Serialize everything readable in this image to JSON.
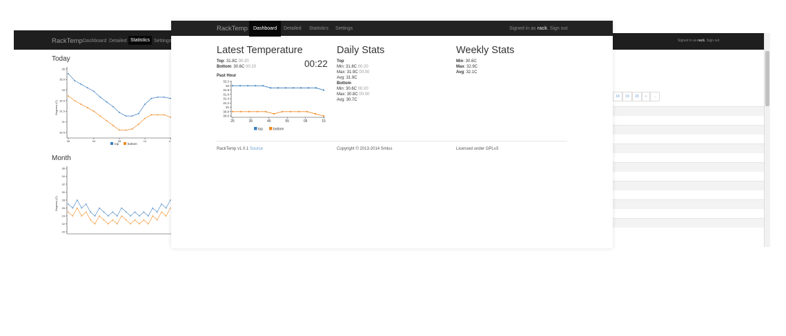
{
  "left_screen": {
    "brand": "RackTemp",
    "nav": [
      "Dashboard",
      "Detailed",
      "Statistics",
      "Settings"
    ],
    "active_nav": "Statistics",
    "today_title": "Today",
    "month_title": "Month",
    "ylabel": "Degrees (C)"
  },
  "main_screen": {
    "brand": "RackTemp",
    "nav": [
      "Dashboard",
      "Detailed",
      "Statistics",
      "Settings"
    ],
    "active_nav": "Dashboard",
    "signed_in_prefix": "Signed in as",
    "user": "rack",
    "signout": "Sign out",
    "latest": {
      "title": "Latest Temperature",
      "top_label": "Top",
      "top_value": "31.8C",
      "top_time": "00:20",
      "bottom_label": "Bottom",
      "bottom_value": "30.6C",
      "bottom_time": "00:20",
      "clock": "00:22",
      "past_hour": "Past Hour"
    },
    "daily": {
      "title": "Daily Stats",
      "top_heading": "Top",
      "top_min": "Min: 31.8C",
      "top_min_time": "00:20",
      "top_max": "Max: 31.9C",
      "top_max_time": "00:00",
      "top_avg": "Avg: 31.9C",
      "bottom_heading": "Bottom",
      "bottom_min": "Min: 30.6C",
      "bottom_min_time": "00:20",
      "bottom_max": "Max: 30.8C",
      "bottom_max_time": "00:00",
      "bottom_avg": "Avg: 30.7C"
    },
    "weekly": {
      "title": "Weekly Stats",
      "min_label": "Min",
      "min_value": ": 30.6C",
      "max_label": "Max",
      "max_value": ": 32.9C",
      "avg_label": "Avg",
      "avg_value": ": 32.1C"
    },
    "footer": {
      "version": "RackTemp v1.0.1",
      "source": "Source",
      "copyright": "Copyright © 2013-2014 Smlus",
      "license": "Licensed under GPLv3"
    }
  },
  "right_screen": {
    "signed_in_prefix": "Signed in as",
    "user": "rack",
    "signout": "Sign out",
    "pager": [
      "18",
      "19",
      "20",
      "»",
      "→"
    ]
  },
  "chart_data": [
    {
      "type": "line",
      "title": "Past Hour",
      "x_ticks": [
        "25",
        "35",
        "45",
        "55",
        "05",
        "15"
      ],
      "ylim": [
        30.6,
        32.2
      ],
      "y_ticks": [
        "32.2",
        "32",
        "31.8",
        "31.6",
        "31.4",
        "31.2",
        "31",
        "30.8",
        "30.6"
      ],
      "series": [
        {
          "name": "top",
          "color": "#3a7ebf",
          "values": [
            32.0,
            32.0,
            32.0,
            32.0,
            32.0,
            31.9,
            31.9,
            31.9,
            31.9,
            31.9,
            31.9,
            31.9,
            31.8
          ]
        },
        {
          "name": "bottom",
          "color": "#f08a24",
          "values": [
            30.8,
            30.8,
            30.8,
            30.8,
            30.8,
            30.7,
            30.8,
            30.8,
            30.8,
            30.8,
            30.7,
            30.6
          ]
        }
      ]
    },
    {
      "type": "line",
      "title": "Today",
      "x_ticks": [
        "00",
        "04",
        "08",
        "12",
        "17"
      ],
      "y_ticks": [
        "36",
        "35.5",
        "33",
        "32.5",
        "31.5",
        "31",
        "30.5"
      ],
      "series": [
        {
          "name": "top",
          "color": "#3a7ebf",
          "values": [
            35.2,
            34.6,
            34.3,
            34.0,
            33.7,
            33.2,
            32.8,
            32.4,
            31.9,
            31.6,
            31.6,
            31.8,
            32.6,
            33.1,
            33.2,
            33.2,
            33.1
          ]
        },
        {
          "name": "bottom",
          "color": "#f08a24",
          "values": [
            33.3,
            32.9,
            32.6,
            32.3,
            32.0,
            31.6,
            31.2,
            30.8,
            30.4,
            30.4,
            30.5,
            30.9,
            31.4,
            31.7,
            31.7,
            31.7,
            31.5
          ]
        }
      ]
    },
    {
      "type": "line",
      "title": "Month",
      "y_ticks": [
        "36",
        "34",
        "32",
        "30",
        "28",
        "26",
        "24",
        "22",
        "20"
      ],
      "series": [
        {
          "name": "top",
          "color": "#3a7ebf",
          "values": [
            27,
            26,
            28,
            26,
            27,
            25,
            24,
            26,
            25,
            24,
            25,
            24,
            26,
            25,
            24,
            25,
            24,
            25,
            24,
            26,
            25,
            27,
            26,
            28
          ]
        },
        {
          "name": "bottom",
          "color": "#f08a24",
          "values": [
            25,
            24,
            26,
            24,
            25,
            23,
            22,
            24,
            23,
            22,
            23,
            22,
            24,
            23,
            22,
            23,
            22,
            23,
            22,
            24,
            23,
            25,
            24,
            26
          ]
        }
      ]
    }
  ]
}
